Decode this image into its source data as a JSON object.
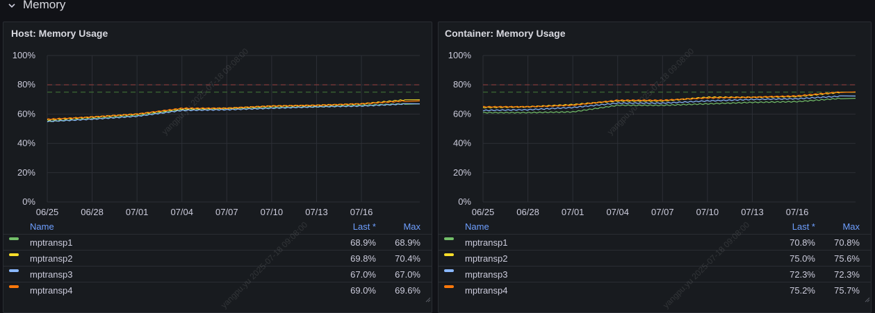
{
  "section": {
    "title": "Memory",
    "chevron_icon": "chevron-down-icon"
  },
  "watermark": "yangpu.yu 2025-07-18 09:08:00",
  "series_colors": {
    "mptransp1": "#73bf69",
    "mptransp2": "#fade2a",
    "mptransp3": "#8ab8ff",
    "mptransp4": "#ff780a"
  },
  "threshold_colors": {
    "upper": "#8b3a3a",
    "lower": "#3d6b34"
  },
  "panels": [
    {
      "title": "Host: Memory Usage",
      "legend": {
        "headers": {
          "name": "Name",
          "last": "Last *",
          "max": "Max"
        },
        "rows": [
          {
            "name": "mptransp1",
            "last": "68.9%",
            "max": "68.9%"
          },
          {
            "name": "mptransp2",
            "last": "69.8%",
            "max": "70.4%"
          },
          {
            "name": "mptransp3",
            "last": "67.0%",
            "max": "67.0%"
          },
          {
            "name": "mptransp4",
            "last": "69.0%",
            "max": "69.6%"
          }
        ]
      },
      "chart_data": {
        "type": "line",
        "title": "Host: Memory Usage",
        "y_ticks": [
          "0%",
          "20%",
          "40%",
          "60%",
          "80%",
          "100%"
        ],
        "x_ticks": [
          "06/25",
          "06/28",
          "07/01",
          "07/04",
          "07/07",
          "07/10",
          "07/13",
          "07/16"
        ],
        "ylim": [
          0,
          100
        ],
        "xlim": [
          "06/25",
          "07/19"
        ],
        "thresholds": [
          75,
          80
        ],
        "grid": true,
        "series": [
          {
            "name": "mptransp1",
            "x": [
              "06/25",
              "06/28",
              "07/01",
              "07/04",
              "07/07",
              "07/10",
              "07/13",
              "07/16",
              "07/19"
            ],
            "values": [
              55,
              57,
              59,
              63,
              63.5,
              64.5,
              65,
              66,
              67
            ]
          },
          {
            "name": "mptransp2",
            "x": [
              "06/25",
              "06/28",
              "07/01",
              "07/04",
              "07/07",
              "07/10",
              "07/13",
              "07/16",
              "07/19"
            ],
            "values": [
              56,
              58,
              60,
              63.5,
              64,
              65.5,
              66,
              67,
              69.8
            ]
          },
          {
            "name": "mptransp3",
            "x": [
              "06/25",
              "06/28",
              "07/01",
              "07/04",
              "07/07",
              "07/10",
              "07/13",
              "07/16",
              "07/19"
            ],
            "values": [
              55,
              56.5,
              58.5,
              62.5,
              63,
              64,
              65,
              65.5,
              67
            ]
          },
          {
            "name": "mptransp4",
            "x": [
              "06/25",
              "06/28",
              "07/01",
              "07/04",
              "07/07",
              "07/10",
              "07/13",
              "07/16",
              "07/19"
            ],
            "values": [
              56.5,
              58,
              60,
              64,
              64,
              65.5,
              66,
              67,
              69
            ]
          }
        ]
      }
    },
    {
      "title": "Container: Memory Usage",
      "legend": {
        "headers": {
          "name": "Name",
          "last": "Last *",
          "max": "Max"
        },
        "rows": [
          {
            "name": "mptransp1",
            "last": "70.8%",
            "max": "70.8%"
          },
          {
            "name": "mptransp2",
            "last": "75.0%",
            "max": "75.6%"
          },
          {
            "name": "mptransp3",
            "last": "72.3%",
            "max": "72.3%"
          },
          {
            "name": "mptransp4",
            "last": "75.2%",
            "max": "75.7%"
          }
        ]
      },
      "chart_data": {
        "type": "line",
        "title": "Container: Memory Usage",
        "y_ticks": [
          "0%",
          "20%",
          "40%",
          "60%",
          "80%",
          "100%"
        ],
        "x_ticks": [
          "06/25",
          "06/28",
          "07/01",
          "07/04",
          "07/07",
          "07/10",
          "07/13",
          "07/16"
        ],
        "ylim": [
          0,
          100
        ],
        "xlim": [
          "06/25",
          "07/19"
        ],
        "thresholds": [
          75,
          80
        ],
        "grid": true,
        "series": [
          {
            "name": "mptransp1",
            "x": [
              "06/25",
              "06/28",
              "07/01",
              "07/04",
              "07/07",
              "07/10",
              "07/13",
              "07/16",
              "07/19"
            ],
            "values": [
              61,
              61,
              61.5,
              66,
              66,
              67,
              68,
              68.5,
              70.8
            ]
          },
          {
            "name": "mptransp2",
            "x": [
              "06/25",
              "06/28",
              "07/01",
              "07/04",
              "07/07",
              "07/10",
              "07/13",
              "07/16",
              "07/19"
            ],
            "values": [
              64.5,
              65,
              66.5,
              69,
              69,
              71.5,
              71.5,
              72,
              75
            ]
          },
          {
            "name": "mptransp3",
            "x": [
              "06/25",
              "06/28",
              "07/01",
              "07/04",
              "07/07",
              "07/10",
              "07/13",
              "07/16",
              "07/19"
            ],
            "values": [
              62.5,
              63,
              64.5,
              67.5,
              67.5,
              69,
              70,
              70.5,
              72.3
            ]
          },
          {
            "name": "mptransp4",
            "x": [
              "06/25",
              "06/28",
              "07/01",
              "07/04",
              "07/07",
              "07/10",
              "07/13",
              "07/16",
              "07/19"
            ],
            "values": [
              65,
              65,
              66,
              69.5,
              69.5,
              71,
              71.5,
              72.5,
              75.2
            ]
          }
        ]
      }
    }
  ]
}
